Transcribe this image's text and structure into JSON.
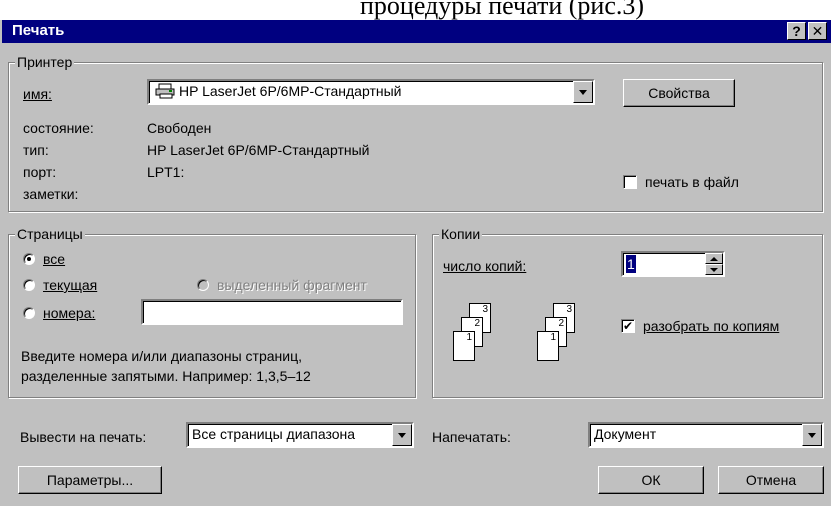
{
  "background": {
    "text": "процедуры печати (рис.3)"
  },
  "window": {
    "title": "Печать",
    "help_btn": "?",
    "close_btn": "✕"
  },
  "printer_group": {
    "legend": "Принтер",
    "name_label": "имя:",
    "name_value": "HP LaserJet 6P/6MP-Стандартный",
    "properties_button": "Свойства",
    "status_label": "состояние:",
    "status_value": "Свободен",
    "type_label": "тип:",
    "type_value": "HP LaserJet 6P/6MP-Стандартный",
    "port_label": "порт:",
    "port_value": "LPT1:",
    "notes_label": "заметки:",
    "print_to_file_label": "печать в файл",
    "print_to_file_checked": false
  },
  "pages_group": {
    "legend": "Страницы",
    "all_label": "все",
    "current_label": "текущая",
    "selection_label": "выделенный фрагмент",
    "numbers_label": "номера:",
    "numbers_value": "",
    "selected": "all",
    "hint_line1": "Введите номера и/или диапазоны страниц,",
    "hint_line2": "разделенные запятыми. Например: 1,3,5–12"
  },
  "copies_group": {
    "legend": "Копии",
    "count_label": "число копий:",
    "count_value": "1",
    "collate_label": "разобрать по копиям",
    "collate_checked": true,
    "page_numbers": [
      "3",
      "2",
      "1"
    ]
  },
  "bottom": {
    "print_range_label": "Вывести на печать:",
    "print_range_value": "Все страницы диапазона",
    "print_what_label": "Напечатать:",
    "print_what_value": "Документ",
    "options_button": "Параметры...",
    "ok_button": "ОК",
    "cancel_button": "Отмена"
  },
  "colors": {
    "dialog_bg": "#c0c0c0",
    "titlebar_bg": "#000080",
    "titlebar_text": "#ffffff"
  }
}
